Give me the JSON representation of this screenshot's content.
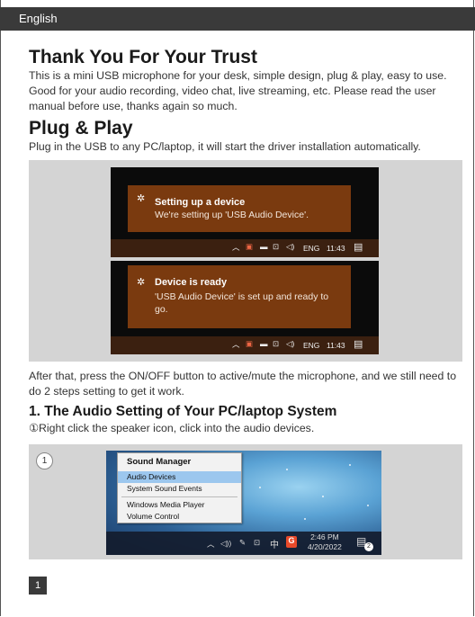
{
  "header": {
    "language": "English"
  },
  "intro": {
    "title": "Thank You For Your Trust",
    "body": "This is a mini USB microphone for your desk, simple design, plug & play, easy to use. Good for your audio recording, video chat, live streaming, etc. Please read the user manual before use, thanks again so much."
  },
  "plug": {
    "title": "Plug & Play",
    "body": "Plug in the USB to any PC/laptop, it will start the driver installation automatically."
  },
  "notifications": [
    {
      "title": "Setting up a device",
      "body": "We're setting up 'USB Audio Device'."
    },
    {
      "title": "Device is ready",
      "body": "'USB Audio Device' is set up and ready to go."
    }
  ],
  "taskbar1": {
    "lang": "ENG",
    "time": "11:43"
  },
  "after_text": "After that, press the ON/OFF button to active/mute the microphone, and we still need to do 2 steps setting to get it work.",
  "step1": {
    "title": "1. The Audio Setting of Your PC/laptop System",
    "marker": "①",
    "instruction": "Right click the speaker icon, click into the audio devices.",
    "image_number": "1"
  },
  "sound_menu": {
    "header": "Sound Manager",
    "items": [
      "Audio Devices",
      "System Sound Events",
      "Windows Media Player",
      "Volume Control"
    ]
  },
  "taskbar2": {
    "ime": "中",
    "time": "2:46 PM",
    "date": "4/20/2022",
    "badge": "2"
  },
  "page_number": "1",
  "colors": {
    "notif_bg": "#7a3a0f",
    "header_bar": "#3a3a3a",
    "menu_selected": "#9cc7ee"
  }
}
